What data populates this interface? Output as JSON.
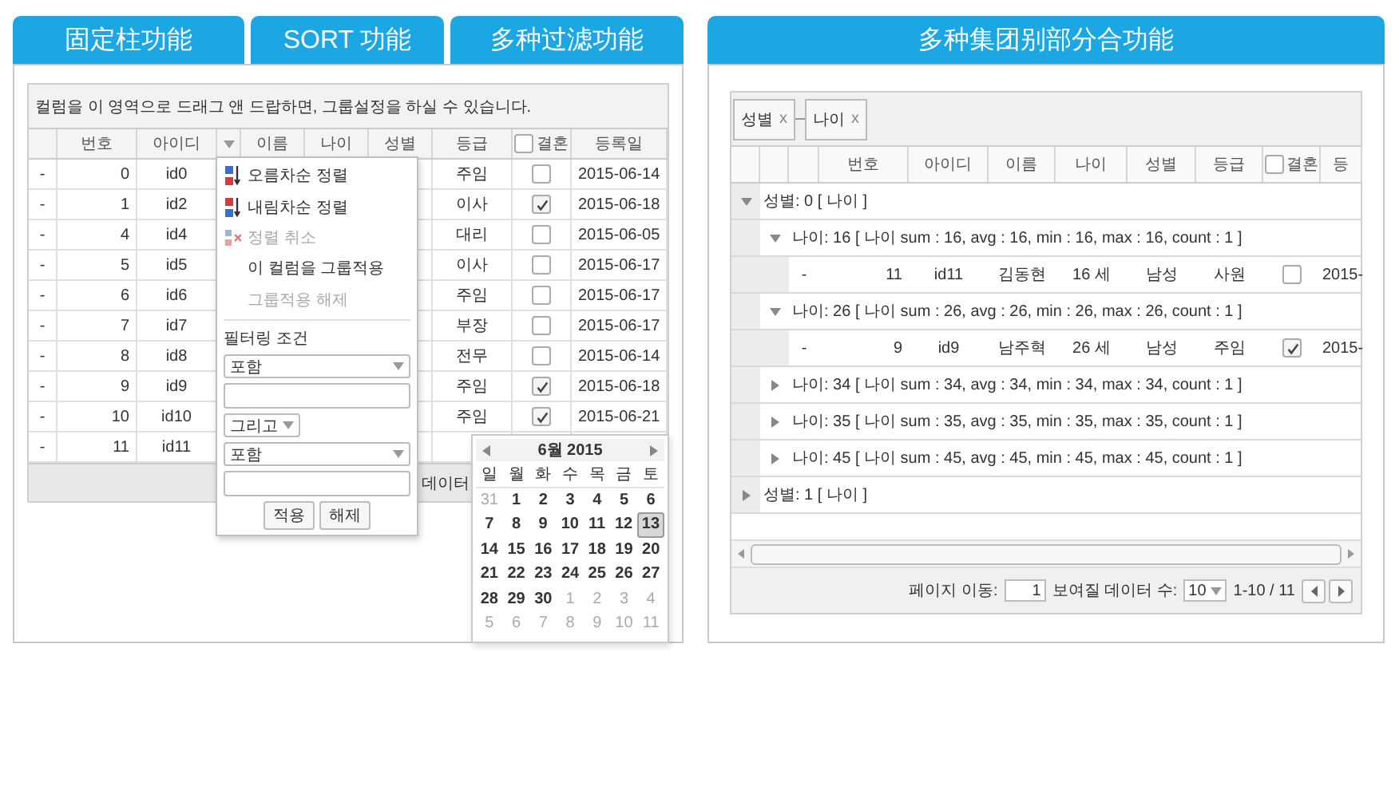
{
  "left_panel": {
    "tabs": [
      {
        "label": "固定柱功能"
      },
      {
        "label": "SORT 功能"
      },
      {
        "label": "多种过滤功能"
      }
    ],
    "grid": {
      "group_hint": "컬럼을 이 영역으로 드래그 앤 드랍하면, 그룹설정을 하실 수 있습니다.",
      "columns": [
        {
          "kind": "blank"
        },
        {
          "kind": "text",
          "label": "번호"
        },
        {
          "kind": "text",
          "label": "아이디"
        },
        {
          "kind": "menu"
        },
        {
          "kind": "text",
          "label": "이름"
        },
        {
          "kind": "text",
          "label": "나이"
        },
        {
          "kind": "text",
          "label": "성별"
        },
        {
          "kind": "text",
          "label": "등급"
        },
        {
          "kind": "check",
          "label": "결혼",
          "checked": false
        },
        {
          "kind": "text",
          "label": "등록일"
        }
      ],
      "rows": [
        {
          "marker": "-",
          "no": "0",
          "id": "id0",
          "grade": "주임",
          "married": false,
          "date": "2015-06-14"
        },
        {
          "marker": "-",
          "no": "1",
          "id": "id2",
          "grade": "이사",
          "married": true,
          "date": "2015-06-18"
        },
        {
          "marker": "-",
          "no": "4",
          "id": "id4",
          "grade": "대리",
          "married": false,
          "date": "2015-06-05"
        },
        {
          "marker": "-",
          "no": "5",
          "id": "id5",
          "grade": "이사",
          "married": false,
          "date": "2015-06-17"
        },
        {
          "marker": "-",
          "no": "6",
          "id": "id6",
          "grade": "주임",
          "married": false,
          "date": "2015-06-17"
        },
        {
          "marker": "-",
          "no": "7",
          "id": "id7",
          "grade": "부장",
          "married": false,
          "date": "2015-06-17"
        },
        {
          "marker": "-",
          "no": "8",
          "id": "id8",
          "grade": "전무",
          "married": false,
          "date": "2015-06-14"
        },
        {
          "marker": "-",
          "no": "9",
          "id": "id9",
          "grade": "주임",
          "married": true,
          "date": "2015-06-18"
        },
        {
          "marker": "-",
          "no": "10",
          "id": "id10",
          "grade": "주임",
          "married": true,
          "date": "2015-06-21"
        },
        {
          "marker": "-",
          "no": "11",
          "id": "id11"
        }
      ],
      "footer_text": "데이터"
    },
    "column_menu": {
      "items": [
        {
          "label": "오름차순 정렬",
          "kind": "sortasc",
          "disabled": false
        },
        {
          "label": "내림차순 정렬",
          "kind": "sortdesc",
          "disabled": false
        },
        {
          "label": "정렬 취소",
          "kind": "sortclear",
          "disabled": true
        },
        {
          "label": "이 컬럼을 그룹적용",
          "kind": "plain",
          "disabled": false
        },
        {
          "label": "그룹적용 해제",
          "kind": "plain",
          "disabled": true
        }
      ],
      "filter": {
        "title": "필터링 조건",
        "condition1": "포함",
        "operator": "그리고",
        "condition2": "포함",
        "buttons": [
          "적용",
          "해제"
        ]
      }
    },
    "date_picker": {
      "title": "6월 2015",
      "weekdays": [
        "일",
        "월",
        "화",
        "수",
        "목",
        "금",
        "토"
      ],
      "weeks": [
        [
          {
            "day": "31",
            "muted": true,
            "selected": false
          },
          {
            "day": "1",
            "muted": false,
            "selected": false
          },
          {
            "day": "2",
            "muted": false,
            "selected": false
          },
          {
            "day": "3",
            "muted": false,
            "selected": false
          },
          {
            "day": "4",
            "muted": false,
            "selected": false
          },
          {
            "day": "5",
            "muted": false,
            "selected": false
          },
          {
            "day": "6",
            "muted": false,
            "selected": false
          }
        ],
        [
          {
            "day": "7",
            "muted": false,
            "selected": false
          },
          {
            "day": "8",
            "muted": false,
            "selected": false
          },
          {
            "day": "9",
            "muted": false,
            "selected": false
          },
          {
            "day": "10",
            "muted": false,
            "selected": false
          },
          {
            "day": "11",
            "muted": false,
            "selected": false
          },
          {
            "day": "12",
            "muted": false,
            "selected": false
          },
          {
            "day": "13",
            "muted": false,
            "selected": true
          }
        ],
        [
          {
            "day": "14",
            "muted": false,
            "selected": false
          },
          {
            "day": "15",
            "muted": false,
            "selected": false
          },
          {
            "day": "16",
            "muted": false,
            "selected": false
          },
          {
            "day": "17",
            "muted": false,
            "selected": false
          },
          {
            "day": "18",
            "muted": false,
            "selected": false
          },
          {
            "day": "19",
            "muted": false,
            "selected": false
          },
          {
            "day": "20",
            "muted": false,
            "selected": false
          }
        ],
        [
          {
            "day": "21",
            "muted": false,
            "selected": false
          },
          {
            "day": "22",
            "muted": false,
            "selected": false
          },
          {
            "day": "23",
            "muted": false,
            "selected": false
          },
          {
            "day": "24",
            "muted": false,
            "selected": false
          },
          {
            "day": "25",
            "muted": false,
            "selected": false
          },
          {
            "day": "26",
            "muted": false,
            "selected": false
          },
          {
            "day": "27",
            "muted": false,
            "selected": false
          }
        ],
        [
          {
            "day": "28",
            "muted": false,
            "selected": false
          },
          {
            "day": "29",
            "muted": false,
            "selected": false
          },
          {
            "day": "30",
            "muted": false,
            "selected": false
          },
          {
            "day": "1",
            "muted": true,
            "selected": false
          },
          {
            "day": "2",
            "muted": true,
            "selected": false
          },
          {
            "day": "3",
            "muted": true,
            "selected": false
          },
          {
            "day": "4",
            "muted": true,
            "selected": false
          }
        ],
        [
          {
            "day": "5",
            "muted": true,
            "selected": false
          },
          {
            "day": "6",
            "muted": true,
            "selected": false
          },
          {
            "day": "7",
            "muted": true,
            "selected": false
          },
          {
            "day": "8",
            "muted": true,
            "selected": false
          },
          {
            "day": "9",
            "muted": true,
            "selected": false
          },
          {
            "day": "10",
            "muted": true,
            "selected": false
          },
          {
            "day": "11",
            "muted": true,
            "selected": false
          }
        ]
      ]
    }
  },
  "right_panel": {
    "tab": {
      "label": "多种集团别部分合功能"
    },
    "grid": {
      "group_chips": [
        {
          "label": "성별",
          "remove": "x"
        },
        {
          "label": "나이",
          "remove": "x"
        }
      ],
      "columns": [
        {
          "kind": "blank"
        },
        {
          "kind": "blank"
        },
        {
          "kind": "blank"
        },
        {
          "kind": "text",
          "label": "번호"
        },
        {
          "kind": "text",
          "label": "아이디"
        },
        {
          "kind": "text",
          "label": "이름"
        },
        {
          "kind": "text",
          "label": "나이"
        },
        {
          "kind": "text",
          "label": "성별"
        },
        {
          "kind": "text",
          "label": "등급"
        },
        {
          "kind": "check",
          "label": "결혼",
          "checked": false
        },
        {
          "kind": "text",
          "label": "등"
        }
      ],
      "rows": [
        {
          "kind": "group",
          "label": "성별: 0 [ 나이 ]",
          "expanded": true,
          "children": [
            {
              "kind": "group",
              "label": "나이: 16 [ 나이 sum : 16, avg : 16, min : 16, max : 16, count : 1 ]",
              "expanded": true,
              "children": [
                {
                  "kind": "data",
                  "cells": [
                    "-",
                    "11",
                    "id11",
                    "김동현",
                    "16 세",
                    "남성",
                    "사원"
                  ],
                  "married": false,
                  "date": "2015-"
                }
              ]
            },
            {
              "kind": "group",
              "label": "나이: 26 [ 나이 sum : 26, avg : 26, min : 26, max : 26, count : 1 ]",
              "expanded": true,
              "children": [
                {
                  "kind": "data",
                  "cells": [
                    "-",
                    "9",
                    "id9",
                    "남주혁",
                    "26 세",
                    "남성",
                    "주임"
                  ],
                  "married": true,
                  "date": "2015-"
                }
              ]
            },
            {
              "kind": "group",
              "label": "나이: 34 [ 나이 sum : 34, avg : 34, min : 34, max : 34, count : 1 ]",
              "expanded": false
            },
            {
              "kind": "group",
              "label": "나이: 35 [ 나이 sum : 35, avg : 35, min : 35, max : 35, count : 1 ]",
              "expanded": false
            },
            {
              "kind": "group",
              "label": "나이: 45 [ 나이 sum : 45, avg : 45, min : 45, max : 45, count : 1 ]",
              "expanded": false
            }
          ]
        },
        {
          "kind": "group",
          "label": "성별: 1 [ 나이 ]",
          "expanded": false
        }
      ],
      "pager": {
        "goto_label": "페이지 이동:",
        "page": "1",
        "size_label": "보여질 데이터 수:",
        "size": "10",
        "range": "1-10 / 11"
      }
    }
  }
}
